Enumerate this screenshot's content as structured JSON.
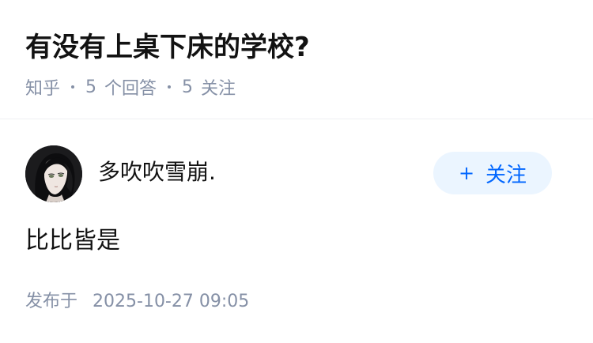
{
  "question": {
    "title": "有没有上桌下床的学校?",
    "source": "知乎",
    "answer_count": "5",
    "answer_label": "个回答",
    "follower_count": "5",
    "follower_label": "关注"
  },
  "answer": {
    "author_name": "多吹吹雪崩.",
    "follow_button_label": "关注",
    "follow_button_icon": "plus-icon",
    "content": "比比皆是",
    "publish_label": "发布于",
    "publish_time": "2025-10-27 09:05"
  },
  "colors": {
    "title": "#121212",
    "meta": "#8590a6",
    "follow_bg": "#ebf5ff",
    "follow_text": "#0066ff",
    "divider": "#eef0f3"
  }
}
